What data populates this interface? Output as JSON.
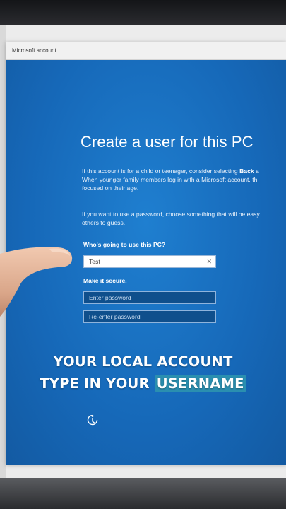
{
  "window": {
    "title": "Microsoft account"
  },
  "setup": {
    "heading": "Create a user for this PC",
    "para1_line1_pre": "If this account is for a child or teenager, consider selecting ",
    "para1_line1_bold": "Back",
    "para1_line1_post": " a",
    "para1_line2": "When younger family members log in with a Microsoft account, th",
    "para1_line3": "focused on their age.",
    "para2_line1": "If you want to use a password, choose something that will be easy",
    "para2_line2": "others to guess.",
    "who_label": "Who's going to use this PC?",
    "username_value": "Test",
    "secure_label": "Make it secure.",
    "password_placeholder": "Enter password",
    "reenter_placeholder": "Re-enter password"
  },
  "caption": {
    "line1": "YOUR LOCAL ACCOUNT",
    "line2_plain": "TYPE IN YOUR ",
    "line2_highlight": "USERNAME"
  },
  "colors": {
    "oobe_blue": "#1668b8",
    "caption_highlight": "#2a8fb0"
  },
  "icons": {
    "clear": "close-icon",
    "accessibility": "accessibility-icon"
  }
}
